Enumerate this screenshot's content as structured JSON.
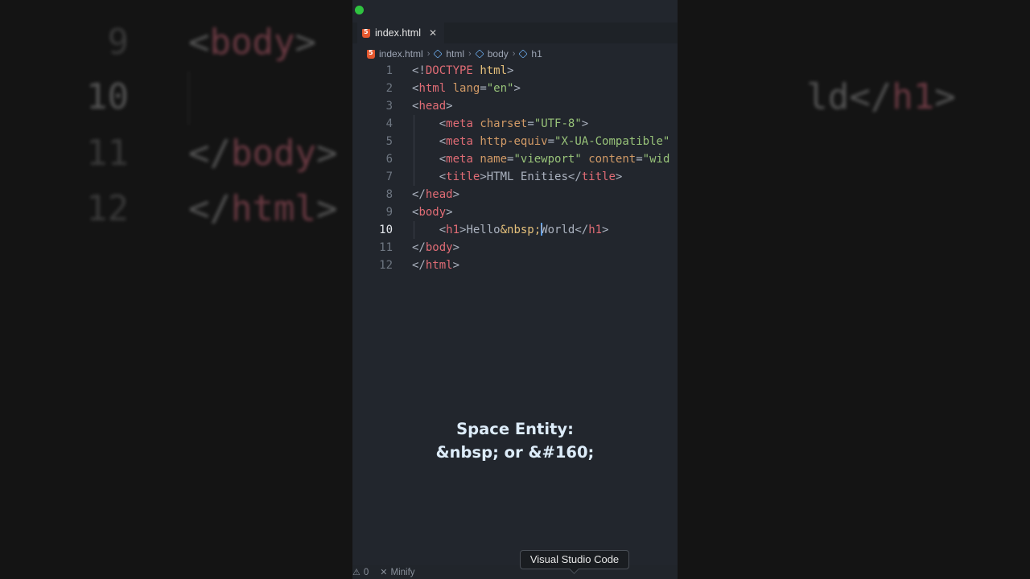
{
  "background_zoom": {
    "lines": [
      {
        "number": "9",
        "active": false,
        "code": [
          [
            "<",
            "p"
          ],
          [
            "body",
            "t"
          ],
          [
            ">",
            "p"
          ]
        ]
      },
      {
        "number": "10",
        "active": true,
        "code": [
          [
            "        <",
            "p"
          ],
          [
            "h1",
            "t"
          ],
          [
            ">",
            "p"
          ],
          [
            "                 ",
            "p"
          ],
          [
            "ld</",
            "p"
          ],
          [
            "h1",
            "t"
          ],
          [
            ">",
            "p"
          ]
        ]
      },
      {
        "number": "11",
        "active": false,
        "code": [
          [
            "</",
            "p"
          ],
          [
            "body",
            "t"
          ],
          [
            ">",
            "p"
          ]
        ]
      },
      {
        "number": "12",
        "active": false,
        "code": [
          [
            "</",
            "p"
          ],
          [
            "html",
            "t"
          ],
          [
            ">",
            "p"
          ]
        ]
      }
    ]
  },
  "editor": {
    "tab": {
      "label": "index.html",
      "close_symbol": "✕"
    },
    "breadcrumb": [
      "index.html",
      "html",
      "body",
      "h1"
    ],
    "active_line": 10,
    "lines": [
      {
        "n": "1",
        "tokens": [
          [
            "<!",
            "p"
          ],
          [
            "DOCTYPE",
            "t"
          ],
          [
            " ",
            "p"
          ],
          [
            "html",
            "x"
          ],
          [
            ">",
            "p"
          ]
        ]
      },
      {
        "n": "2",
        "tokens": [
          [
            "<",
            "p"
          ],
          [
            "html",
            "t"
          ],
          [
            " ",
            "p"
          ],
          [
            "lang",
            "a"
          ],
          [
            "=",
            "p"
          ],
          [
            "\"en\"",
            "s"
          ],
          [
            ">",
            "p"
          ]
        ]
      },
      {
        "n": "3",
        "tokens": [
          [
            "<",
            "p"
          ],
          [
            "head",
            "t"
          ],
          [
            ">",
            "p"
          ]
        ]
      },
      {
        "n": "4",
        "tokens": [
          [
            "    <",
            "p"
          ],
          [
            "meta",
            "t"
          ],
          [
            " ",
            "p"
          ],
          [
            "charset",
            "a"
          ],
          [
            "=",
            "p"
          ],
          [
            "\"UTF-8\"",
            "s"
          ],
          [
            ">",
            "p"
          ]
        ]
      },
      {
        "n": "5",
        "tokens": [
          [
            "    <",
            "p"
          ],
          [
            "meta",
            "t"
          ],
          [
            " ",
            "p"
          ],
          [
            "http-equiv",
            "a"
          ],
          [
            "=",
            "p"
          ],
          [
            "\"X-UA-Compatible\"",
            "s"
          ]
        ]
      },
      {
        "n": "6",
        "tokens": [
          [
            "    <",
            "p"
          ],
          [
            "meta",
            "t"
          ],
          [
            " ",
            "p"
          ],
          [
            "name",
            "a"
          ],
          [
            "=",
            "p"
          ],
          [
            "\"viewport\"",
            "s"
          ],
          [
            " ",
            "p"
          ],
          [
            "content",
            "a"
          ],
          [
            "=",
            "p"
          ],
          [
            "\"wid",
            "s"
          ]
        ]
      },
      {
        "n": "7",
        "tokens": [
          [
            "    <",
            "p"
          ],
          [
            "title",
            "t"
          ],
          [
            ">HTML Enities</",
            "p"
          ],
          [
            "title",
            "t"
          ],
          [
            ">",
            "p"
          ]
        ]
      },
      {
        "n": "8",
        "tokens": [
          [
            "</",
            "p"
          ],
          [
            "head",
            "t"
          ],
          [
            ">",
            "p"
          ]
        ]
      },
      {
        "n": "9",
        "tokens": [
          [
            "<",
            "p"
          ],
          [
            "body",
            "t"
          ],
          [
            ">",
            "p"
          ]
        ]
      },
      {
        "n": "10",
        "tokens": [
          [
            "    <",
            "p"
          ],
          [
            "h1",
            "t"
          ],
          [
            ">Hello",
            "p"
          ],
          [
            "&nbsp;",
            "x"
          ],
          [
            "|",
            "cursor"
          ],
          [
            "World</",
            "p"
          ],
          [
            "h1",
            "t"
          ],
          [
            ">",
            "p"
          ]
        ]
      },
      {
        "n": "11",
        "tokens": [
          [
            "</",
            "p"
          ],
          [
            "body",
            "t"
          ],
          [
            ">",
            "p"
          ]
        ]
      },
      {
        "n": "12",
        "tokens": [
          [
            "</",
            "p"
          ],
          [
            "html",
            "t"
          ],
          [
            ">",
            "p"
          ]
        ]
      }
    ]
  },
  "caption": {
    "line1": "Space Entity:",
    "line2": "&nbsp; or &#160;"
  },
  "tooltip": {
    "label": "Visual Studio Code"
  },
  "statusbar": {
    "problems_icon": "warning-icon",
    "problems_count": "0",
    "minify_icon": "x-icon",
    "minify_label": "Minify"
  },
  "colors": {
    "tag": "#e06c75",
    "attribute": "#d19a66",
    "string": "#98c379",
    "entity": "#e5c07b",
    "caption": "#ddecf9",
    "window_dot": "#2fc340"
  }
}
